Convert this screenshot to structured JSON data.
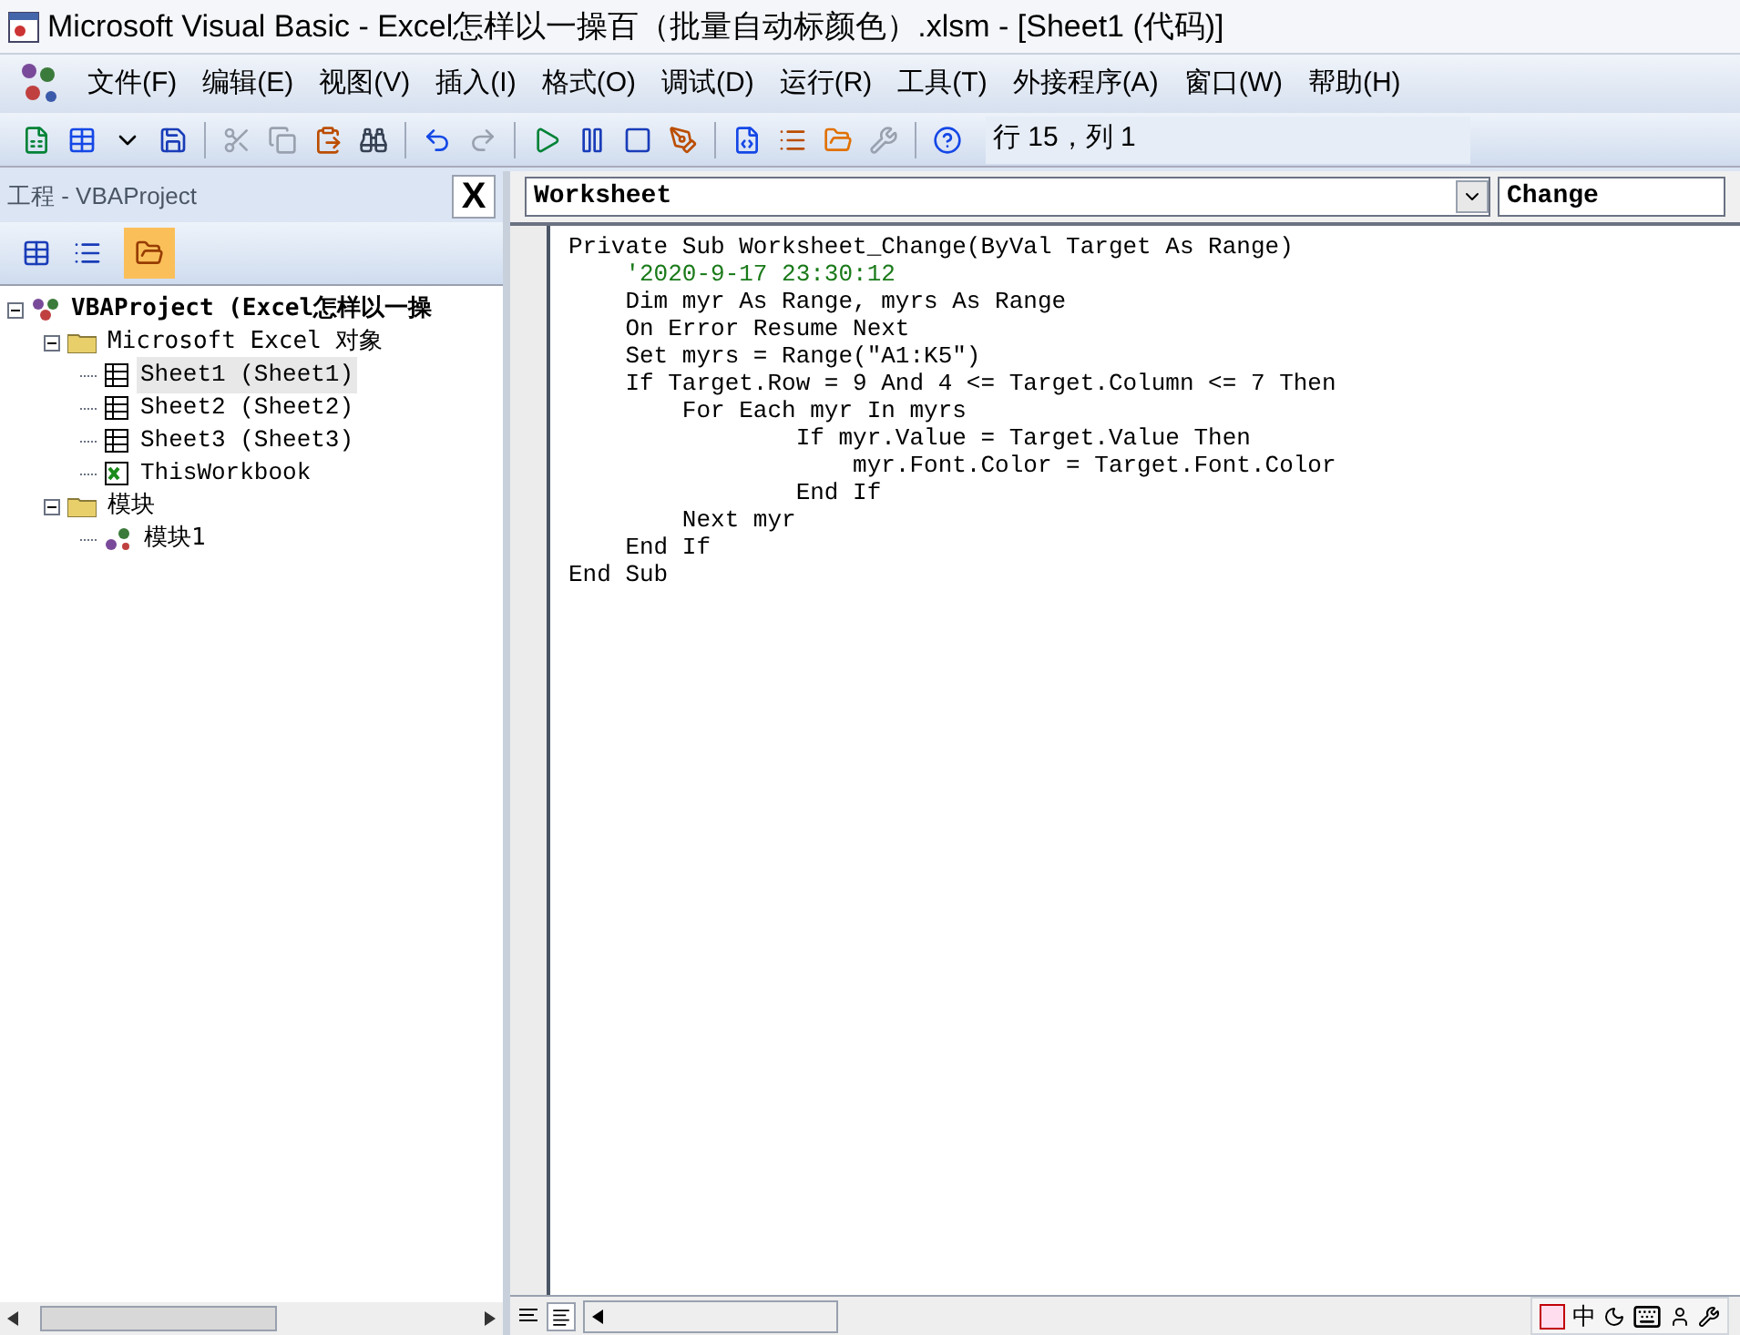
{
  "window": {
    "title": "Microsoft Visual Basic - Excel怎样以一操百（批量自动标颜色）.xlsm - [Sheet1 (代码)]"
  },
  "menu": [
    "文件(F)",
    "编辑(E)",
    "视图(V)",
    "插入(I)",
    "格式(O)",
    "调试(D)",
    "运行(R)",
    "工具(T)",
    "外接程序(A)",
    "窗口(W)",
    "帮助(H)"
  ],
  "toolbar": {
    "position": "行 15，列 1"
  },
  "project_panel": {
    "title": "工程 - VBAProject",
    "close": "X",
    "tree": [
      {
        "label": "VBAProject (Excel怎样以一操",
        "kind": "project",
        "selected": false,
        "expanded": true,
        "children": [
          {
            "label": "Microsoft Excel 对象",
            "kind": "folder",
            "selected": false,
            "expanded": true,
            "children": [
              {
                "label": "Sheet1 (Sheet1)",
                "kind": "sheet",
                "selected": true
              },
              {
                "label": "Sheet2 (Sheet2)",
                "kind": "sheet",
                "selected": false
              },
              {
                "label": "Sheet3 (Sheet3)",
                "kind": "sheet",
                "selected": false
              },
              {
                "label": "ThisWorkbook",
                "kind": "workbook",
                "selected": false
              }
            ]
          },
          {
            "label": "模块",
            "kind": "folder",
            "selected": false,
            "expanded": true,
            "children": [
              {
                "label": "模块1",
                "kind": "module",
                "selected": false
              }
            ]
          }
        ]
      }
    ]
  },
  "code_window": {
    "object": "Worksheet",
    "procedure": "Change",
    "lines": [
      {
        "text": "Private Sub Worksheet_Change(ByVal Target As Range)",
        "kind": "code"
      },
      {
        "text": "    '2020-9-17 23:30:12",
        "kind": "comment"
      },
      {
        "text": "    Dim myr As Range, myrs As Range",
        "kind": "code"
      },
      {
        "text": "    On Error Resume Next",
        "kind": "code"
      },
      {
        "text": "    Set myrs = Range(\"A1:K5\")",
        "kind": "code"
      },
      {
        "text": "    If Target.Row = 9 And 4 <= Target.Column <= 7 Then",
        "kind": "code"
      },
      {
        "text": "        For Each myr In myrs",
        "kind": "code"
      },
      {
        "text": "                If myr.Value = Target.Value Then",
        "kind": "code"
      },
      {
        "text": "                    myr.Font.Color = Target.Font.Color",
        "kind": "code"
      },
      {
        "text": "                End If",
        "kind": "code"
      },
      {
        "text": "        Next myr",
        "kind": "code"
      },
      {
        "text": "    End If",
        "kind": "code"
      },
      {
        "text": "End Sub",
        "kind": "code"
      }
    ]
  },
  "ime_bar": {
    "label": "中"
  }
}
